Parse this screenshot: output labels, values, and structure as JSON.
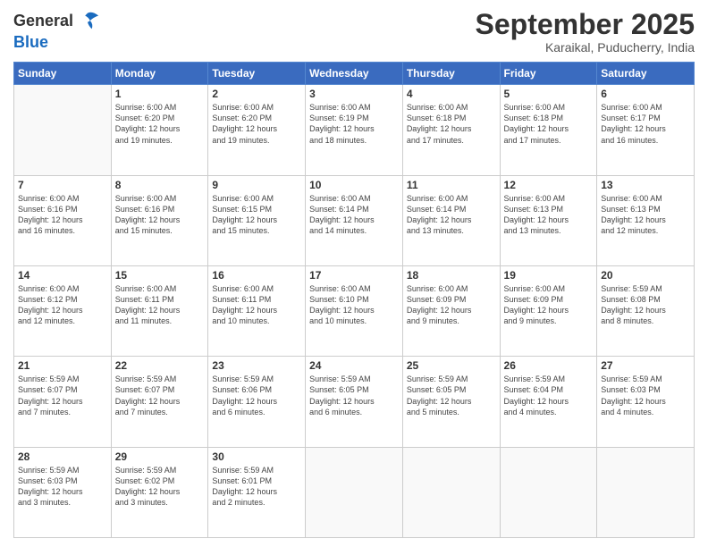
{
  "header": {
    "logo": {
      "line1": "General",
      "line2": "Blue"
    },
    "month_title": "September 2025",
    "subtitle": "Karaikal, Puducherry, India"
  },
  "weekdays": [
    "Sunday",
    "Monday",
    "Tuesday",
    "Wednesday",
    "Thursday",
    "Friday",
    "Saturday"
  ],
  "weeks": [
    [
      {
        "day": "",
        "info": ""
      },
      {
        "day": "1",
        "info": "Sunrise: 6:00 AM\nSunset: 6:20 PM\nDaylight: 12 hours\nand 19 minutes."
      },
      {
        "day": "2",
        "info": "Sunrise: 6:00 AM\nSunset: 6:20 PM\nDaylight: 12 hours\nand 19 minutes."
      },
      {
        "day": "3",
        "info": "Sunrise: 6:00 AM\nSunset: 6:19 PM\nDaylight: 12 hours\nand 18 minutes."
      },
      {
        "day": "4",
        "info": "Sunrise: 6:00 AM\nSunset: 6:18 PM\nDaylight: 12 hours\nand 17 minutes."
      },
      {
        "day": "5",
        "info": "Sunrise: 6:00 AM\nSunset: 6:18 PM\nDaylight: 12 hours\nand 17 minutes."
      },
      {
        "day": "6",
        "info": "Sunrise: 6:00 AM\nSunset: 6:17 PM\nDaylight: 12 hours\nand 16 minutes."
      }
    ],
    [
      {
        "day": "7",
        "info": "Sunrise: 6:00 AM\nSunset: 6:16 PM\nDaylight: 12 hours\nand 16 minutes."
      },
      {
        "day": "8",
        "info": "Sunrise: 6:00 AM\nSunset: 6:16 PM\nDaylight: 12 hours\nand 15 minutes."
      },
      {
        "day": "9",
        "info": "Sunrise: 6:00 AM\nSunset: 6:15 PM\nDaylight: 12 hours\nand 15 minutes."
      },
      {
        "day": "10",
        "info": "Sunrise: 6:00 AM\nSunset: 6:14 PM\nDaylight: 12 hours\nand 14 minutes."
      },
      {
        "day": "11",
        "info": "Sunrise: 6:00 AM\nSunset: 6:14 PM\nDaylight: 12 hours\nand 13 minutes."
      },
      {
        "day": "12",
        "info": "Sunrise: 6:00 AM\nSunset: 6:13 PM\nDaylight: 12 hours\nand 13 minutes."
      },
      {
        "day": "13",
        "info": "Sunrise: 6:00 AM\nSunset: 6:13 PM\nDaylight: 12 hours\nand 12 minutes."
      }
    ],
    [
      {
        "day": "14",
        "info": "Sunrise: 6:00 AM\nSunset: 6:12 PM\nDaylight: 12 hours\nand 12 minutes."
      },
      {
        "day": "15",
        "info": "Sunrise: 6:00 AM\nSunset: 6:11 PM\nDaylight: 12 hours\nand 11 minutes."
      },
      {
        "day": "16",
        "info": "Sunrise: 6:00 AM\nSunset: 6:11 PM\nDaylight: 12 hours\nand 10 minutes."
      },
      {
        "day": "17",
        "info": "Sunrise: 6:00 AM\nSunset: 6:10 PM\nDaylight: 12 hours\nand 10 minutes."
      },
      {
        "day": "18",
        "info": "Sunrise: 6:00 AM\nSunset: 6:09 PM\nDaylight: 12 hours\nand 9 minutes."
      },
      {
        "day": "19",
        "info": "Sunrise: 6:00 AM\nSunset: 6:09 PM\nDaylight: 12 hours\nand 9 minutes."
      },
      {
        "day": "20",
        "info": "Sunrise: 5:59 AM\nSunset: 6:08 PM\nDaylight: 12 hours\nand 8 minutes."
      }
    ],
    [
      {
        "day": "21",
        "info": "Sunrise: 5:59 AM\nSunset: 6:07 PM\nDaylight: 12 hours\nand 7 minutes."
      },
      {
        "day": "22",
        "info": "Sunrise: 5:59 AM\nSunset: 6:07 PM\nDaylight: 12 hours\nand 7 minutes."
      },
      {
        "day": "23",
        "info": "Sunrise: 5:59 AM\nSunset: 6:06 PM\nDaylight: 12 hours\nand 6 minutes."
      },
      {
        "day": "24",
        "info": "Sunrise: 5:59 AM\nSunset: 6:05 PM\nDaylight: 12 hours\nand 6 minutes."
      },
      {
        "day": "25",
        "info": "Sunrise: 5:59 AM\nSunset: 6:05 PM\nDaylight: 12 hours\nand 5 minutes."
      },
      {
        "day": "26",
        "info": "Sunrise: 5:59 AM\nSunset: 6:04 PM\nDaylight: 12 hours\nand 4 minutes."
      },
      {
        "day": "27",
        "info": "Sunrise: 5:59 AM\nSunset: 6:03 PM\nDaylight: 12 hours\nand 4 minutes."
      }
    ],
    [
      {
        "day": "28",
        "info": "Sunrise: 5:59 AM\nSunset: 6:03 PM\nDaylight: 12 hours\nand 3 minutes."
      },
      {
        "day": "29",
        "info": "Sunrise: 5:59 AM\nSunset: 6:02 PM\nDaylight: 12 hours\nand 3 minutes."
      },
      {
        "day": "30",
        "info": "Sunrise: 5:59 AM\nSunset: 6:01 PM\nDaylight: 12 hours\nand 2 minutes."
      },
      {
        "day": "",
        "info": ""
      },
      {
        "day": "",
        "info": ""
      },
      {
        "day": "",
        "info": ""
      },
      {
        "day": "",
        "info": ""
      }
    ]
  ]
}
